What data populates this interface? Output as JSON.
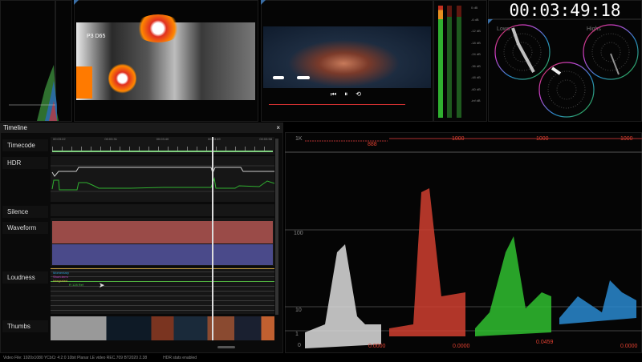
{
  "top": {
    "video1_label": "P3 D65",
    "timecode": "00:03:49:18",
    "meter_scale": [
      "0 dB",
      "-6 dB",
      "-12 dB",
      "-18 dB",
      "-24 dB",
      "-36 dB",
      "-48 dB",
      "-60 dB",
      "-inf dB"
    ],
    "vectorscopes": {
      "lows": "Lows",
      "highs": "Highs"
    },
    "player_controls": [
      "skip-back",
      "pause",
      "loop"
    ],
    "playback_progress": 0.55
  },
  "timeline": {
    "title": "Timeline",
    "close": "×",
    "ruler": [
      "00:03:22",
      "00:03:31",
      "00:03:40",
      "00:03:49",
      "00:03:58"
    ],
    "tracks": [
      "Timecode",
      "HDR",
      "Silence",
      "Waveform",
      "Loudness",
      "Thumbs"
    ],
    "loudness_legend": [
      "Momentary",
      "Short-term",
      "Integrated",
      "R 128 Ref"
    ],
    "playhead_fraction": 0.725
  },
  "waveform_scope": {
    "y_labels": [
      "1K",
      "100",
      "10",
      "1",
      "0"
    ],
    "peak_values": [
      "888",
      "1000",
      "1000",
      "1000"
    ],
    "min_values": [
      "0.0000",
      "0.0000",
      "0.0459",
      "0.0000"
    ],
    "channel_colors": [
      "#dddddd",
      "#e04030",
      "#30c030",
      "#2a8ad0"
    ]
  },
  "status": {
    "file_info": "Video File: 1920x1080 YCbCr 4:2:0 10bit Planar LE video REC.709 BT2020 2.38",
    "hdr": "HDR stats enabled",
    "zero": "0"
  }
}
